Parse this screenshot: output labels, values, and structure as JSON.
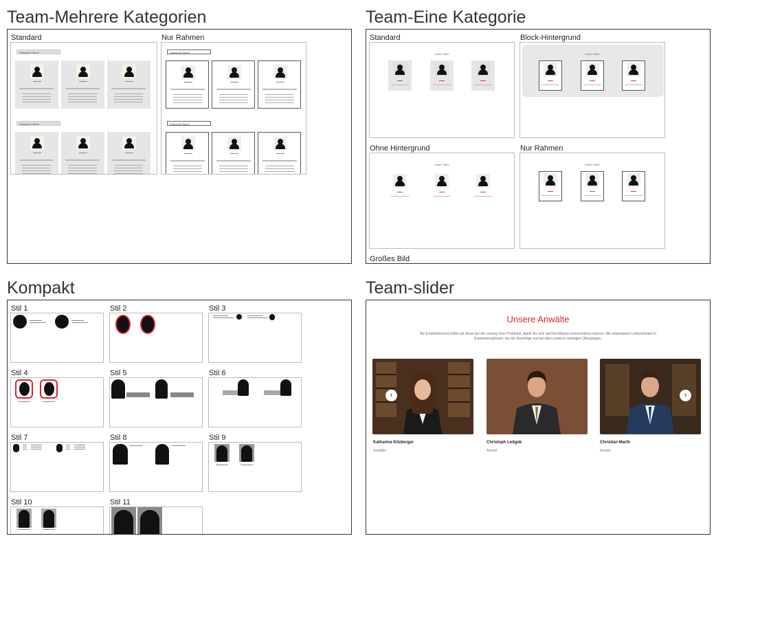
{
  "sections": {
    "multi": {
      "title": "Team-Mehrere Kategorien",
      "labels": [
        "Standard",
        "Nur Rahmen"
      ],
      "category_tag": "Kategorie Name"
    },
    "single": {
      "title": "Team-Eine Kategorie",
      "labels": [
        "Standard",
        "Block-Hintergrund",
        "Ohne Hintergrund",
        "Nur Rahmen",
        "Großes Bild"
      ],
      "team_heading": "Unser Team"
    },
    "compact": {
      "title": "Kompakt",
      "styles": [
        "Stil 1",
        "Stil 2",
        "Stil 3",
        "Stil 4",
        "Stil 5",
        "Stil 6",
        "Stil 7",
        "Stil 8",
        "Stil 9",
        "Stil 10",
        "Stil 11"
      ]
    },
    "slider": {
      "title": "Team-slider",
      "heading": "Unsere Anwälte",
      "text": "Bei [Unternehmen] helfen wir Ihnen bei der Lösung Ihrer Probleme, damit Sie sich auf Ihre Mission konzentrieren können. Wir unterstützen Unternehmen in Expansionsphasen, bei der Nachfolge und bei allen anderen wichtigen Übergängen.",
      "people": [
        {
          "name": "Katharina Kitzberger",
          "role": "Anwältin"
        },
        {
          "name": "Christoph Leitgeb",
          "role": "Anwalt"
        },
        {
          "name": "Christian Marth",
          "role": "Anwalt"
        }
      ],
      "prev_icon": "chevron-left-icon",
      "next_icon": "chevron-right-icon",
      "accent_color": "#d42a2a"
    }
  }
}
